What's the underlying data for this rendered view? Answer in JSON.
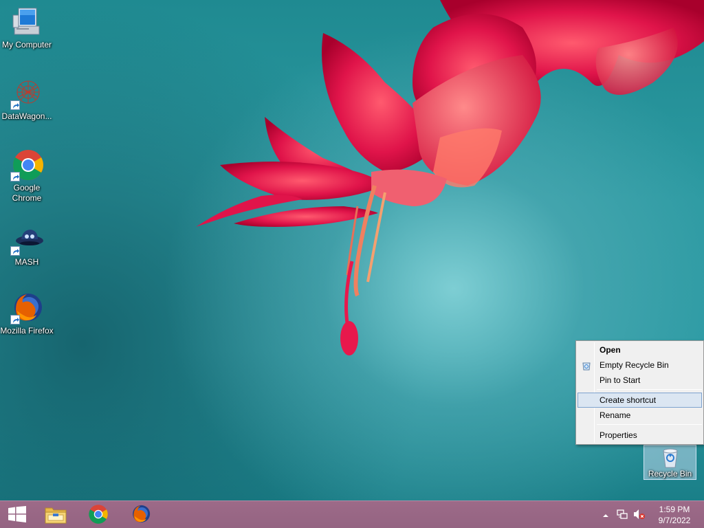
{
  "desktop": {
    "icons": [
      {
        "label": "My Computer",
        "icon": "computer-icon",
        "shortcut": false
      },
      {
        "label": "DataWagon...",
        "icon": "datawagon-icon",
        "shortcut": true
      },
      {
        "label": "Google Chrome",
        "icon": "chrome-icon",
        "shortcut": true
      },
      {
        "label": "MASH",
        "icon": "mash-icon",
        "shortcut": true
      },
      {
        "label": "Mozilla Firefox",
        "icon": "firefox-icon",
        "shortcut": true
      }
    ],
    "recycle_bin": {
      "label": "Recycle Bin",
      "icon": "recycle-bin-icon",
      "selected": true
    }
  },
  "context_menu": {
    "items": [
      {
        "label": "Open",
        "bold": true
      },
      {
        "label": "Empty Recycle Bin",
        "icon": "recycle-bin-small-icon"
      },
      {
        "label": "Pin to Start"
      },
      {
        "label": "Create shortcut",
        "highlighted": true
      },
      {
        "label": "Rename"
      },
      {
        "label": "Properties"
      }
    ]
  },
  "taskbar": {
    "start": {
      "icon": "windows-logo-icon"
    },
    "pinned": [
      {
        "name": "File Explorer",
        "icon": "file-explorer-icon"
      },
      {
        "name": "Google Chrome",
        "icon": "chrome-icon"
      },
      {
        "name": "Mozilla Firefox",
        "icon": "firefox-icon"
      }
    ],
    "tray": {
      "show_hidden_icon": "chevron-up-icon",
      "network_icon": "network-icon",
      "volume_icon": "volume-muted-icon"
    },
    "clock": {
      "time": "1:59 PM",
      "date": "9/7/2022"
    }
  },
  "colors": {
    "taskbar": "#9d6a88",
    "desktop_teal": "#2c9aa2",
    "menu_highlight": "#dbe6f2",
    "menu_highlight_border": "#7da2ce"
  }
}
